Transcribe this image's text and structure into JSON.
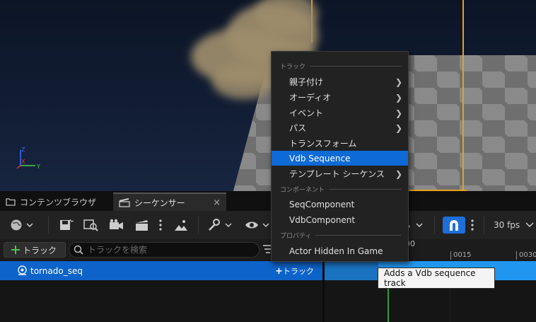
{
  "tabs": {
    "content_browser": "コンテンツブラウザ",
    "sequencer": "シーケンサー",
    "close": "×"
  },
  "toolbar": {
    "fps": "30 fps"
  },
  "trackbar": {
    "add_track_label": "トラック",
    "search_placeholder": "トラックを検索"
  },
  "timeline": {
    "ticks": [
      "0015",
      "0030"
    ],
    "partial_label": "00"
  },
  "track": {
    "name": "tornado_seq",
    "add_label": "トラック"
  },
  "menu": {
    "sections": {
      "track": "トラック",
      "component": "コンポーネント",
      "property": "プロパティ"
    },
    "items": [
      {
        "label": "親子付け",
        "submenu": true
      },
      {
        "label": "オーディオ",
        "submenu": true
      },
      {
        "label": "イベント",
        "submenu": true
      },
      {
        "label": "パス",
        "submenu": true
      },
      {
        "label": "トランスフォーム",
        "submenu": false
      },
      {
        "label": "Vdb Sequence",
        "submenu": false,
        "highlighted": true
      },
      {
        "label": "テンプレート シーケンス",
        "submenu": true
      }
    ],
    "components": [
      {
        "label": "SeqComponent"
      },
      {
        "label": "VdbComponent"
      }
    ],
    "properties": [
      {
        "label": "Actor Hidden In Game"
      }
    ]
  },
  "tooltip": {
    "text": "Adds a Vdb sequence track"
  },
  "axis": {
    "x": "X",
    "y": "Y",
    "z": "Z"
  },
  "colors": {
    "accent": "#0e6ad6",
    "selected_row": "#0d63c9",
    "bounds": "#e8a020"
  }
}
